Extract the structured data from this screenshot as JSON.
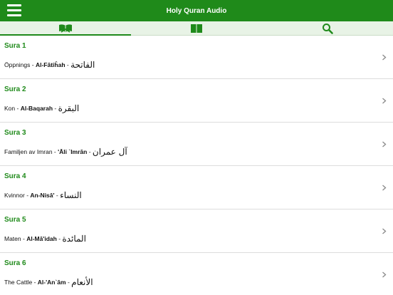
{
  "header": {
    "title": "Holy Quran Audio",
    "bg": "#1f8a1a"
  },
  "tabs": [
    {
      "icon": "quran-book-icon",
      "active": true
    },
    {
      "icon": "open-book-icon",
      "active": false
    },
    {
      "icon": "search-icon",
      "active": false
    }
  ],
  "suras": [
    {
      "label": "Sura 1",
      "name": "Öppnings",
      "translit": "Al-Fātiĥah",
      "arabic": "الفاتحة"
    },
    {
      "label": "Sura 2",
      "name": "Kon",
      "translit": "Al-Baqarah",
      "arabic": "البقرة"
    },
    {
      "label": "Sura 3",
      "name": "Familjen av Imran",
      "translit": "'Āli `Imrān",
      "arabic": "آل عمران"
    },
    {
      "label": "Sura 4",
      "name": "Kvinnor",
      "translit": "An-Nisā'",
      "arabic": "النساء"
    },
    {
      "label": "Sura 5",
      "name": "Maten",
      "translit": "Al-Mā'idah",
      "arabic": "المائدة"
    },
    {
      "label": "Sura 6",
      "name": "The Cattle",
      "translit": "Al-'An`ām",
      "arabic": "الأنعام"
    }
  ]
}
